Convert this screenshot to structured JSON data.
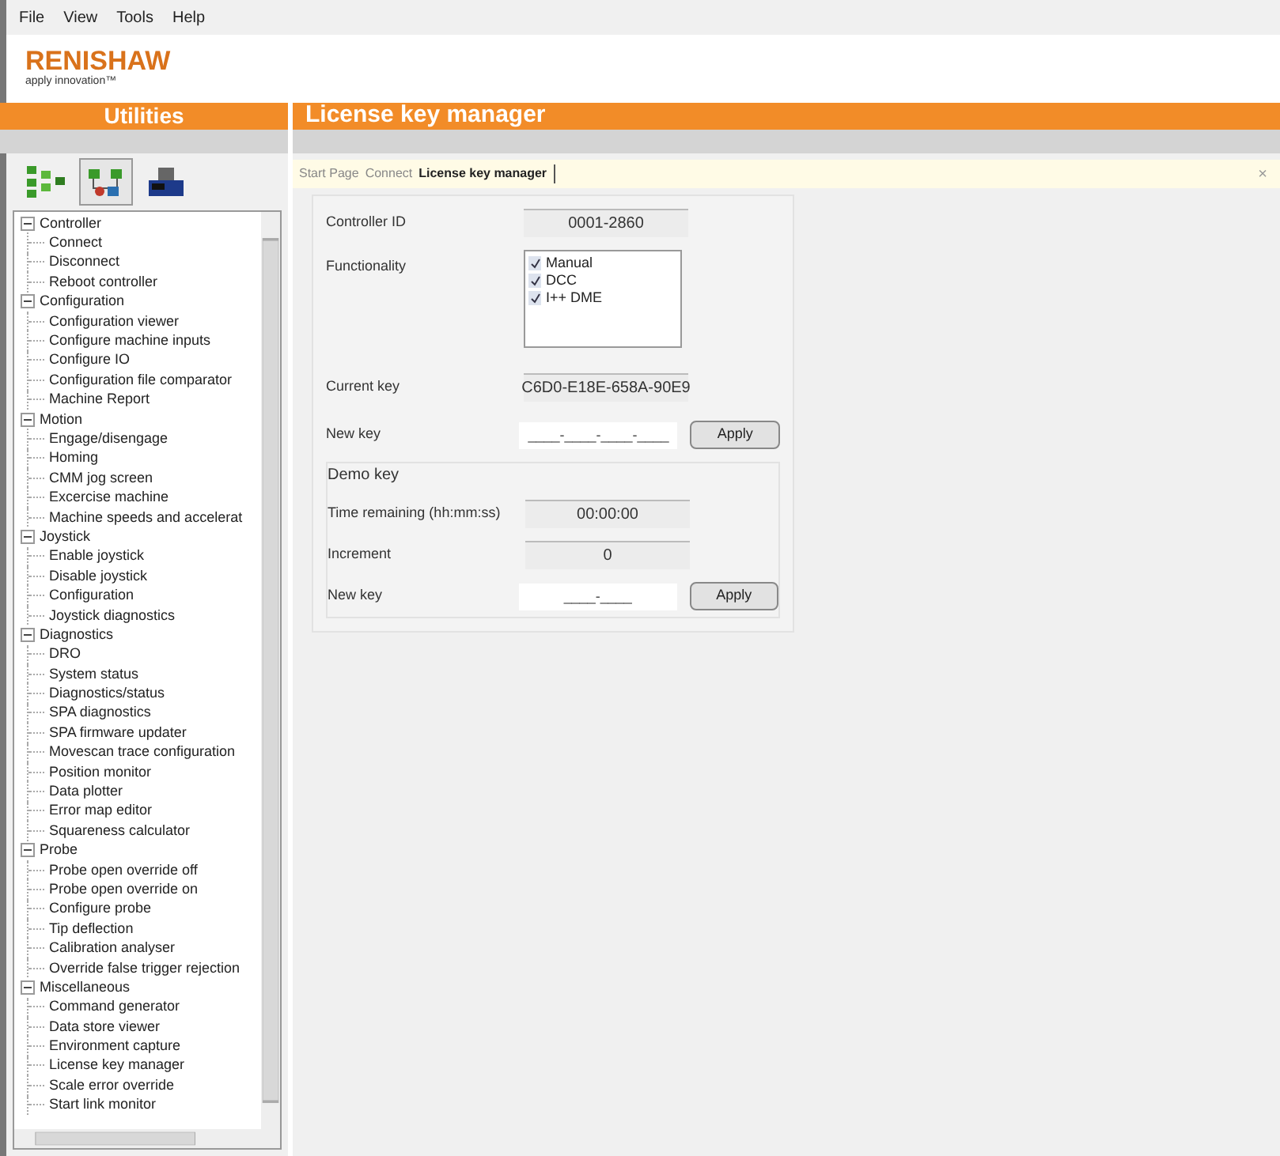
{
  "menu": [
    "File",
    "View",
    "Tools",
    "Help"
  ],
  "logo": {
    "name": "RENISHAW",
    "tagline": "apply innovation™"
  },
  "left_header": "Utilities",
  "main_header": "License key manager",
  "toolbar": [
    {
      "kind": "tree",
      "selected": false
    },
    {
      "kind": "device",
      "selected": true
    },
    {
      "kind": "machine",
      "selected": false
    }
  ],
  "tree": [
    {
      "label": "Controller",
      "expanded": true,
      "children": [
        {
          "label": "Connect"
        },
        {
          "label": "Disconnect"
        },
        {
          "label": "Reboot controller"
        }
      ]
    },
    {
      "label": "Configuration",
      "expanded": true,
      "children": [
        {
          "label": "Configuration viewer"
        },
        {
          "label": "Configure machine inputs"
        },
        {
          "label": "Configure IO"
        },
        {
          "label": "Configuration file comparator"
        },
        {
          "label": "Machine Report"
        }
      ]
    },
    {
      "label": "Motion",
      "expanded": true,
      "children": [
        {
          "label": "Engage/disengage"
        },
        {
          "label": "Homing"
        },
        {
          "label": "CMM jog screen"
        },
        {
          "label": "Excercise machine"
        },
        {
          "label": "Machine speeds and accelerat"
        }
      ]
    },
    {
      "label": "Joystick",
      "expanded": true,
      "children": [
        {
          "label": "Enable joystick"
        },
        {
          "label": "Disable joystick"
        },
        {
          "label": "Configuration"
        },
        {
          "label": "Joystick diagnostics"
        }
      ]
    },
    {
      "label": "Diagnostics",
      "expanded": true,
      "children": [
        {
          "label": "DRO"
        },
        {
          "label": "System status"
        },
        {
          "label": "Diagnostics/status"
        },
        {
          "label": "SPA diagnostics"
        },
        {
          "label": "SPA firmware updater"
        },
        {
          "label": "Movescan trace configuration"
        },
        {
          "label": "Position monitor"
        },
        {
          "label": "Data plotter"
        },
        {
          "label": "Error map editor"
        },
        {
          "label": "Squareness calculator"
        }
      ]
    },
    {
      "label": "Probe",
      "expanded": true,
      "children": [
        {
          "label": "Probe open override off"
        },
        {
          "label": "Probe open override on"
        },
        {
          "label": "Configure probe"
        },
        {
          "label": "Tip deflection"
        },
        {
          "label": "Calibration analyser"
        },
        {
          "label": "Override false trigger rejection"
        }
      ]
    },
    {
      "label": "Miscellaneous",
      "expanded": true,
      "children": [
        {
          "label": "Command generator"
        },
        {
          "label": "Data store viewer"
        },
        {
          "label": "Environment capture"
        },
        {
          "label": "License key manager"
        },
        {
          "label": "Scale error override"
        },
        {
          "label": "Start link monitor"
        }
      ]
    }
  ],
  "tabs": [
    {
      "label": "Start Page",
      "selected": false
    },
    {
      "label": "Connect",
      "selected": false
    },
    {
      "label": "License key manager",
      "selected": true
    }
  ],
  "close": "×",
  "form": {
    "controller_id": {
      "label": "Controller ID",
      "value": "0001-2860"
    },
    "functionality": {
      "label": "Functionality",
      "options": [
        {
          "label": "Manual",
          "checked": true
        },
        {
          "label": "DCC",
          "checked": true
        },
        {
          "label": "I++ DME",
          "checked": true
        }
      ]
    },
    "current_key": {
      "label": "Current key",
      "value": "C6D0-E18E-658A-90E9"
    },
    "new_key": {
      "label": "New key",
      "placeholder": "____-____-____-____",
      "button": "Apply"
    },
    "demo": {
      "title": "Demo key",
      "time_remaining": {
        "label": "Time remaining (hh:mm:ss)",
        "value": "00:00:00"
      },
      "increment": {
        "label": "Increment",
        "value": "0"
      },
      "new_key": {
        "label": "New key",
        "placeholder": "____-____",
        "button": "Apply"
      }
    }
  }
}
